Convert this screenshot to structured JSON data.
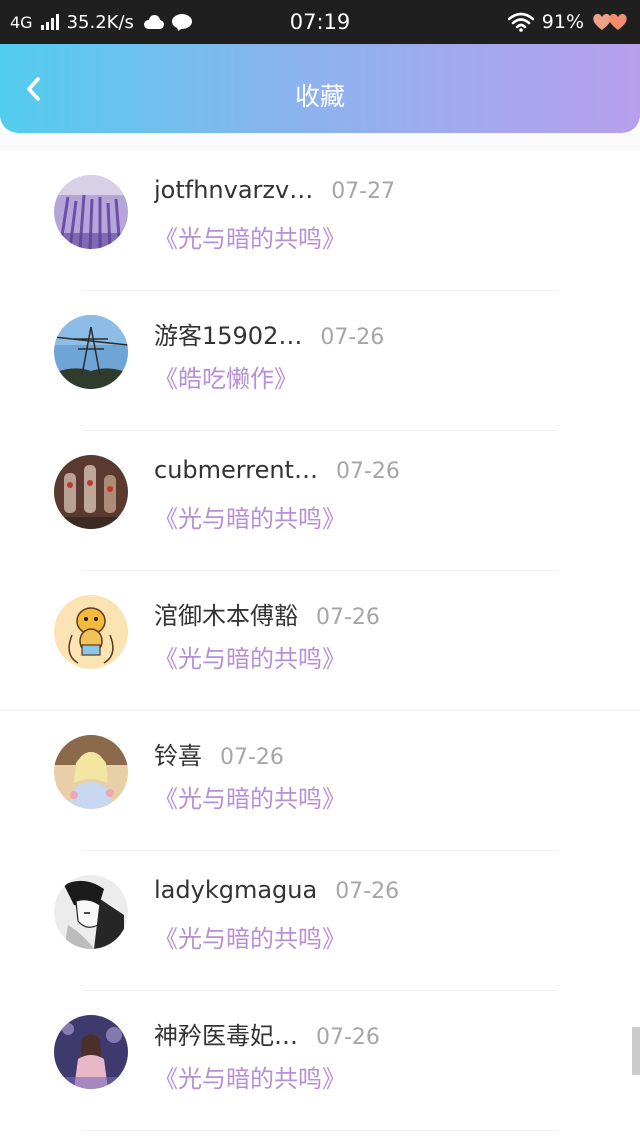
{
  "status_bar": {
    "network": "4G",
    "speed": "35.2K/s",
    "time": "07:19",
    "battery": "91%"
  },
  "header": {
    "title": "收藏"
  },
  "items": [
    {
      "username": "jotfhnvarzv…",
      "date": "07-27",
      "book": "《光与暗的共鸣》",
      "avatar": "lavender-field"
    },
    {
      "username": "游客15902…",
      "date": "07-26",
      "book": "《皓吃懒作》",
      "avatar": "power-tower-sky"
    },
    {
      "username": "cubmerrent…",
      "date": "07-26",
      "book": "《光与暗的共鸣》",
      "avatar": "glass-bottles"
    },
    {
      "username": "涫御木本傅豁",
      "date": "07-26",
      "book": "《光与暗的共鸣》",
      "avatar": "cartoon-character"
    },
    {
      "username": "铃喜",
      "date": "07-26",
      "book": "《光与暗的共鸣》",
      "avatar": "anime-girl"
    },
    {
      "username": "ladykgmagua",
      "date": "07-26",
      "book": "《光与暗的共鸣》",
      "avatar": "manga-sketch"
    },
    {
      "username": "神矜医毒妃…",
      "date": "07-26",
      "book": "《光与暗的共鸣》",
      "avatar": "girl-back-view"
    }
  ],
  "colors": {
    "header_gradient_start": "#52cdee",
    "header_gradient_end": "#b89fec",
    "book_title": "#b88fd6",
    "date": "#a6a6a6"
  }
}
